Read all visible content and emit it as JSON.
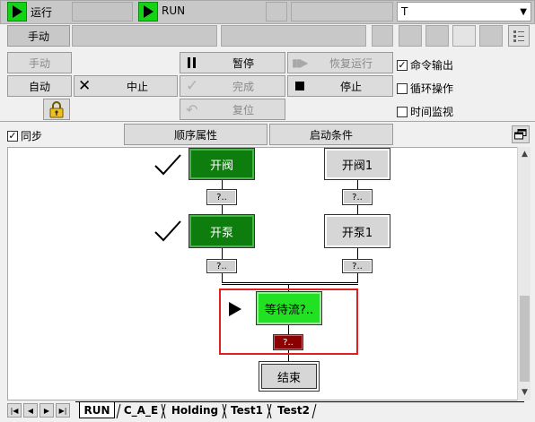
{
  "top_bar": {
    "mode_label": "运行",
    "run_label": "RUN",
    "dropdown_value": "T"
  },
  "row2": {
    "manual_label": "手动"
  },
  "controls": {
    "manual": "手动",
    "auto": "自动",
    "abort": "中止",
    "pause": "暂停",
    "resume": "恢复运行",
    "complete": "完成",
    "stop": "停止",
    "reset": "复位"
  },
  "options": {
    "command_output": "命令输出",
    "loop_operation": "循环操作",
    "time_monitor": "时间监视",
    "sync": "同步"
  },
  "options_state": {
    "command_output": true,
    "loop_operation": false,
    "time_monitor": false,
    "sync": true
  },
  "sub_buttons": {
    "sequence_props": "顺序属性",
    "start_conditions": "启动条件"
  },
  "diagram": {
    "steps": {
      "open_valve": "开阀",
      "open_valve_1": "开阀1",
      "open_pump": "开泵",
      "open_pump_1": "开泵1",
      "wait_flow": "等待流?..",
      "end": "结束"
    },
    "transition_label": "?.."
  },
  "tabs": [
    "RUN",
    "C_A_E",
    "Holding",
    "Test1",
    "Test2"
  ],
  "active_tab": "RUN",
  "colors": {
    "running_green": "#0d7d0d",
    "active_green": "#22e022",
    "highlight_red": "#e02020",
    "error_transition": "#8b0000"
  }
}
